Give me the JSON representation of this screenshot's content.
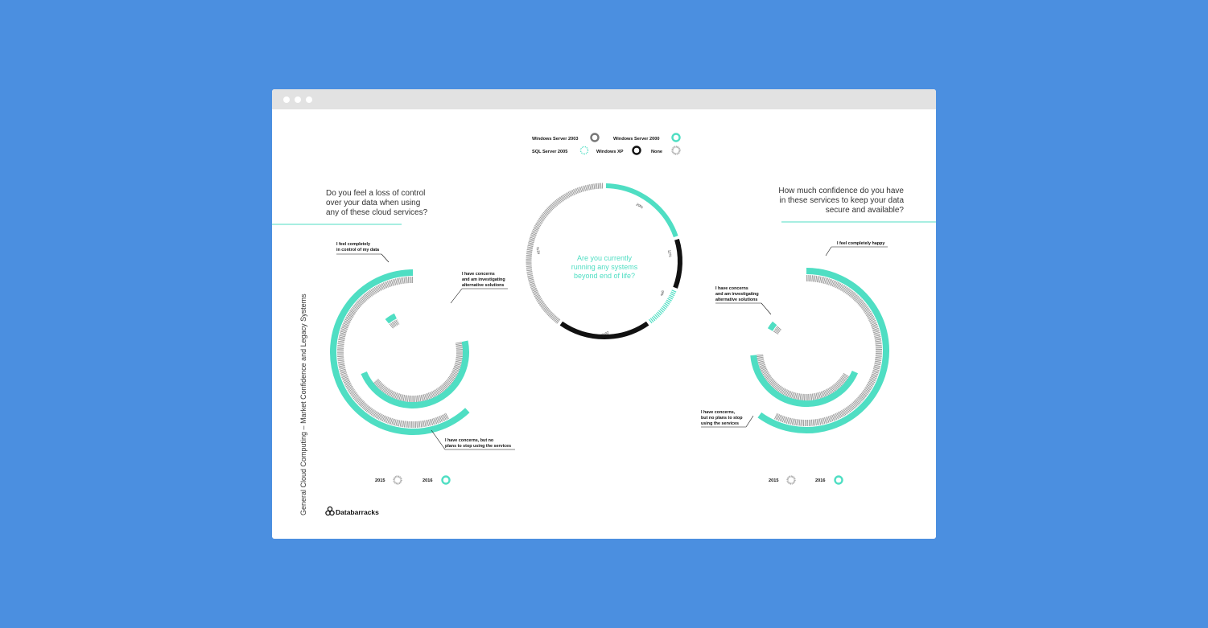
{
  "colors": {
    "background": "#4b8fe0",
    "teal": "#4fdec3",
    "black": "#111111",
    "grey": "#777777",
    "hatch": "#8a8a8a"
  },
  "browser": {
    "dots": 3
  },
  "side_title": "General Cloud Computing – Market Confidence and Legacy Systems",
  "brand": {
    "name": "Databarracks",
    "icon": "databarracks-logo-icon"
  },
  "legend": {
    "items": [
      {
        "label": "Windows Server 2003",
        "style": "grey-ring"
      },
      {
        "label": "Windows Server 2000",
        "style": "teal-ring"
      },
      {
        "label": "SQL Server 2005",
        "style": "teal-dotted-ring"
      },
      {
        "label": "Windows XP",
        "style": "black-ring"
      },
      {
        "label": "None",
        "style": "hatched-ring"
      }
    ]
  },
  "left": {
    "question": [
      "Do you feel a loss of control",
      "over your data when using",
      "any of these cloud services?"
    ],
    "labels": {
      "a": [
        "I feel completely",
        "in control of my data"
      ],
      "b": [
        "I have concerns",
        "and am investigating",
        "alternative solutions"
      ],
      "c": [
        "I have concerns, but no",
        "plans to stop using the services"
      ]
    },
    "year_legend": [
      {
        "label": "2015",
        "style": "hatched"
      },
      {
        "label": "2016",
        "style": "teal"
      }
    ]
  },
  "right": {
    "question": [
      "How much confidence do you have",
      "in these services to keep your data",
      "secure and available?"
    ],
    "labels": {
      "a": [
        "I feel completely happy"
      ],
      "b": [
        "I have concerns",
        "and am investigating",
        "alternative solutions"
      ],
      "c": [
        "I have concerns,",
        "but no plans to stop",
        "using the services"
      ]
    },
    "year_legend": [
      {
        "label": "2015",
        "style": "hatched"
      },
      {
        "label": "2016",
        "style": "teal"
      }
    ]
  },
  "center": {
    "question": [
      "Are you currently",
      "running any systems",
      "beyond end of life?"
    ]
  },
  "chart_data": [
    {
      "type": "pie",
      "title": "Are you currently running any systems beyond end of life?",
      "series": [
        {
          "name": "Windows Server 2000",
          "value": 20,
          "label": "20%"
        },
        {
          "name": "Windows XP",
          "value": 11,
          "label": "11%"
        },
        {
          "name": "SQL Server 2005",
          "value": 9,
          "label": "9%"
        },
        {
          "name": "Windows XP",
          "value": 20,
          "label": "20%"
        },
        {
          "name": "None",
          "value": 40,
          "label": "41%"
        }
      ]
    },
    {
      "type": "radial-bar",
      "title": "Do you feel a loss of control over your data when using any of these cloud services?",
      "categories": [
        "I feel completely in control of my data",
        "I have concerns and am investigating alternative solutions",
        "I have concerns, but no plans to stop using the services"
      ],
      "series": [
        {
          "name": "2015",
          "values": [
            58,
            4,
            43
          ]
        },
        {
          "name": "2016",
          "values": [
            62,
            4,
            47
          ]
        }
      ]
    },
    {
      "type": "radial-bar",
      "title": "How much confidence do you have in these services to keep your data secure and available?",
      "categories": [
        "I feel completely happy",
        "I have concerns and am investigating alternative solutions",
        "I have concerns, but no plans to stop using the services"
      ],
      "series": [
        {
          "name": "2015",
          "values": [
            57,
            3,
            40
          ]
        },
        {
          "name": "2016",
          "values": [
            60,
            3,
            42
          ]
        }
      ]
    }
  ]
}
